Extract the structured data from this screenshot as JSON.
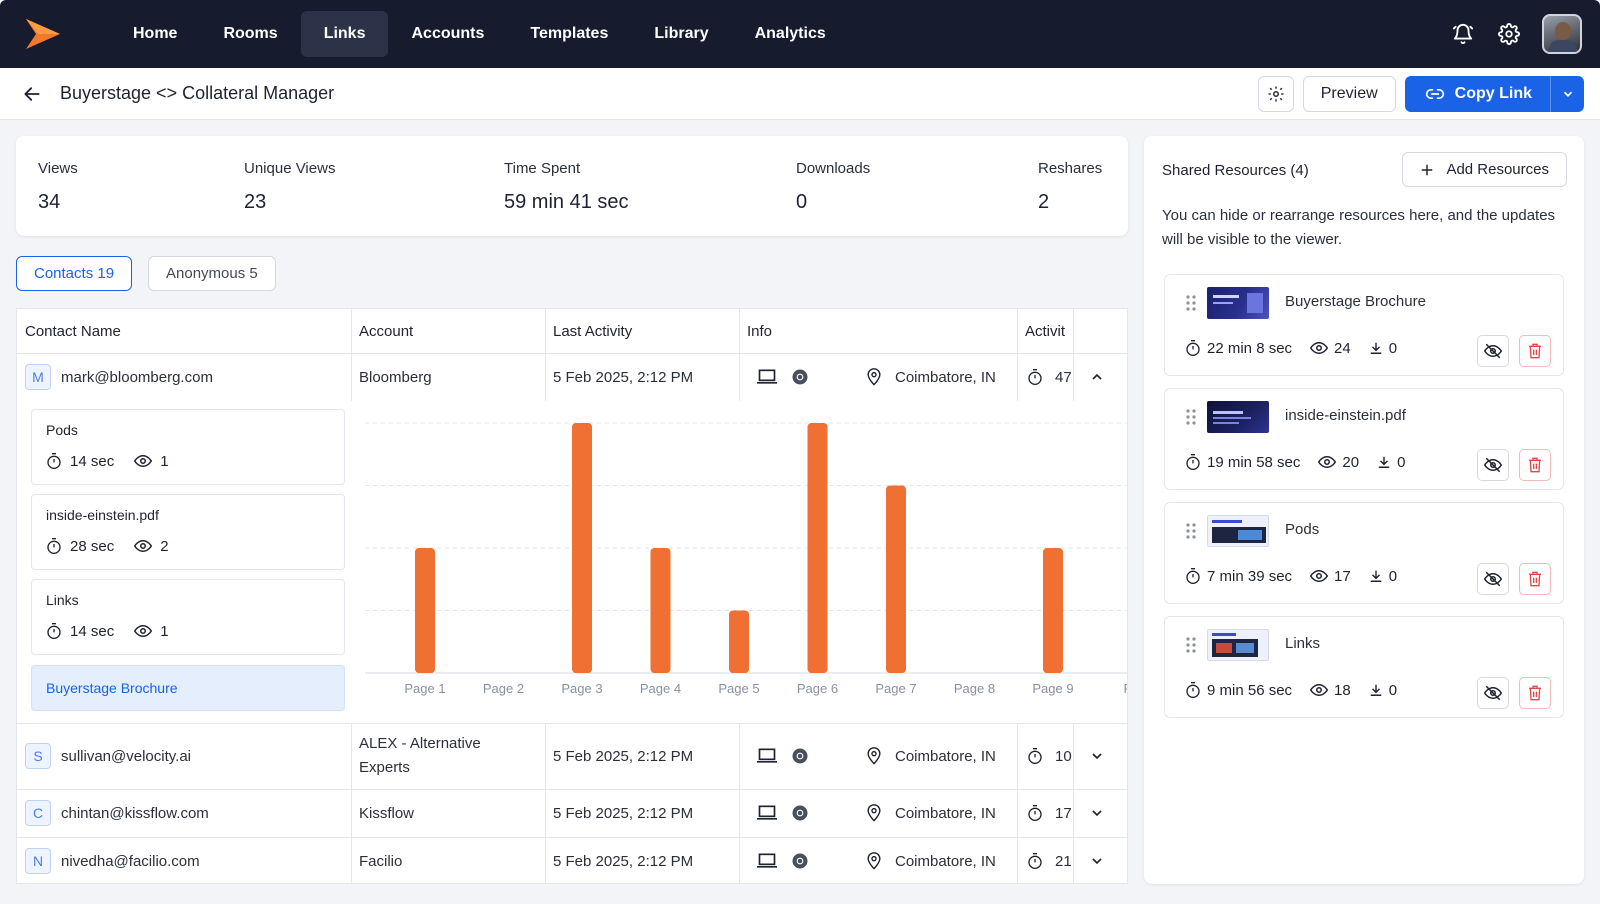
{
  "nav": {
    "items": [
      {
        "label": "Home"
      },
      {
        "label": "Rooms"
      },
      {
        "label": "Links",
        "active": true
      },
      {
        "label": "Accounts"
      },
      {
        "label": "Templates"
      },
      {
        "label": "Library"
      },
      {
        "label": "Analytics"
      }
    ],
    "icons": [
      "bell-icon",
      "gear-icon",
      "avatar"
    ]
  },
  "header": {
    "title": "Buyerstage <> Collateral Manager",
    "preview_label": "Preview",
    "copy_link_label": "Copy Link"
  },
  "stats": [
    {
      "label": "Views",
      "value": "34"
    },
    {
      "label": "Unique Views",
      "value": "23"
    },
    {
      "label": "Time Spent",
      "value": "59 min 41 sec"
    },
    {
      "label": "Downloads",
      "value": "0"
    },
    {
      "label": "Reshares",
      "value": "2"
    }
  ],
  "tabs": {
    "contacts": "Contacts 19",
    "anonymous": "Anonymous 5"
  },
  "table": {
    "headers": [
      "Contact Name",
      "Account",
      "Last Activity",
      "Info",
      "Activit"
    ],
    "rows": [
      {
        "initial": "M",
        "name": "mark@bloomberg.com",
        "account": "Bloomberg",
        "last_activity": "5 Feb 2025, 2:12 PM",
        "location": "Coimbatore, IN",
        "activity": "47"
      },
      {
        "initial": "S",
        "name": "sullivan@velocity.ai",
        "account": "ALEX - Alternative Experts",
        "account_line1": "ALEX - Alternative",
        "account_line2": "Experts",
        "last_activity": "5 Feb 2025, 2:12 PM",
        "location": "Coimbatore, IN",
        "activity": "10"
      },
      {
        "initial": "C",
        "name": "chintan@kissflow.com",
        "account": "Kissflow",
        "last_activity": "5 Feb 2025, 2:12 PM",
        "location": "Coimbatore, IN",
        "activity": "17"
      },
      {
        "initial": "N",
        "name": "nivedha@facilio.com",
        "account": "Facilio",
        "last_activity": "5 Feb 2025, 2:12 PM",
        "location": "Coimbatore, IN",
        "activity": "21"
      }
    ]
  },
  "expanded_resources": [
    {
      "name": "Pods",
      "time": "14 sec",
      "views": "1"
    },
    {
      "name": "inside-einstein.pdf",
      "time": "28 sec",
      "views": "2"
    },
    {
      "name": "Links",
      "time": "14 sec",
      "views": "1"
    },
    {
      "name": "Buyerstage Brochure",
      "selected": true
    }
  ],
  "chart_data": {
    "type": "bar",
    "categories": [
      "Page 1",
      "Page 2",
      "Page 3",
      "Page 4",
      "Page 5",
      "Page 6",
      "Page 7",
      "Page 8",
      "Page 9",
      "Pa"
    ],
    "values": [
      2,
      0,
      4,
      2,
      1,
      4,
      3,
      0,
      2,
      0
    ],
    "ylim": [
      0,
      4
    ],
    "color": "#f07034",
    "grid": true
  },
  "shared": {
    "title": "Shared Resources (4)",
    "add_label": "Add Resources",
    "description": "You can hide or rearrange resources here, and the updates will be visible to the viewer.",
    "items": [
      {
        "name": "Buyerstage Brochure",
        "time": "22 min 8 sec",
        "views": "24",
        "downloads": "0"
      },
      {
        "name": "inside-einstein.pdf",
        "time": "19 min 58 sec",
        "views": "20",
        "downloads": "0"
      },
      {
        "name": "Pods",
        "time": "7 min 39 sec",
        "views": "17",
        "downloads": "0"
      },
      {
        "name": "Links",
        "time": "9 min 56 sec",
        "views": "18",
        "downloads": "0"
      }
    ]
  },
  "colors": {
    "nav_bg": "#161b2e",
    "accent": "#1a63e6",
    "bar": "#f07034",
    "danger": "#e04848"
  }
}
